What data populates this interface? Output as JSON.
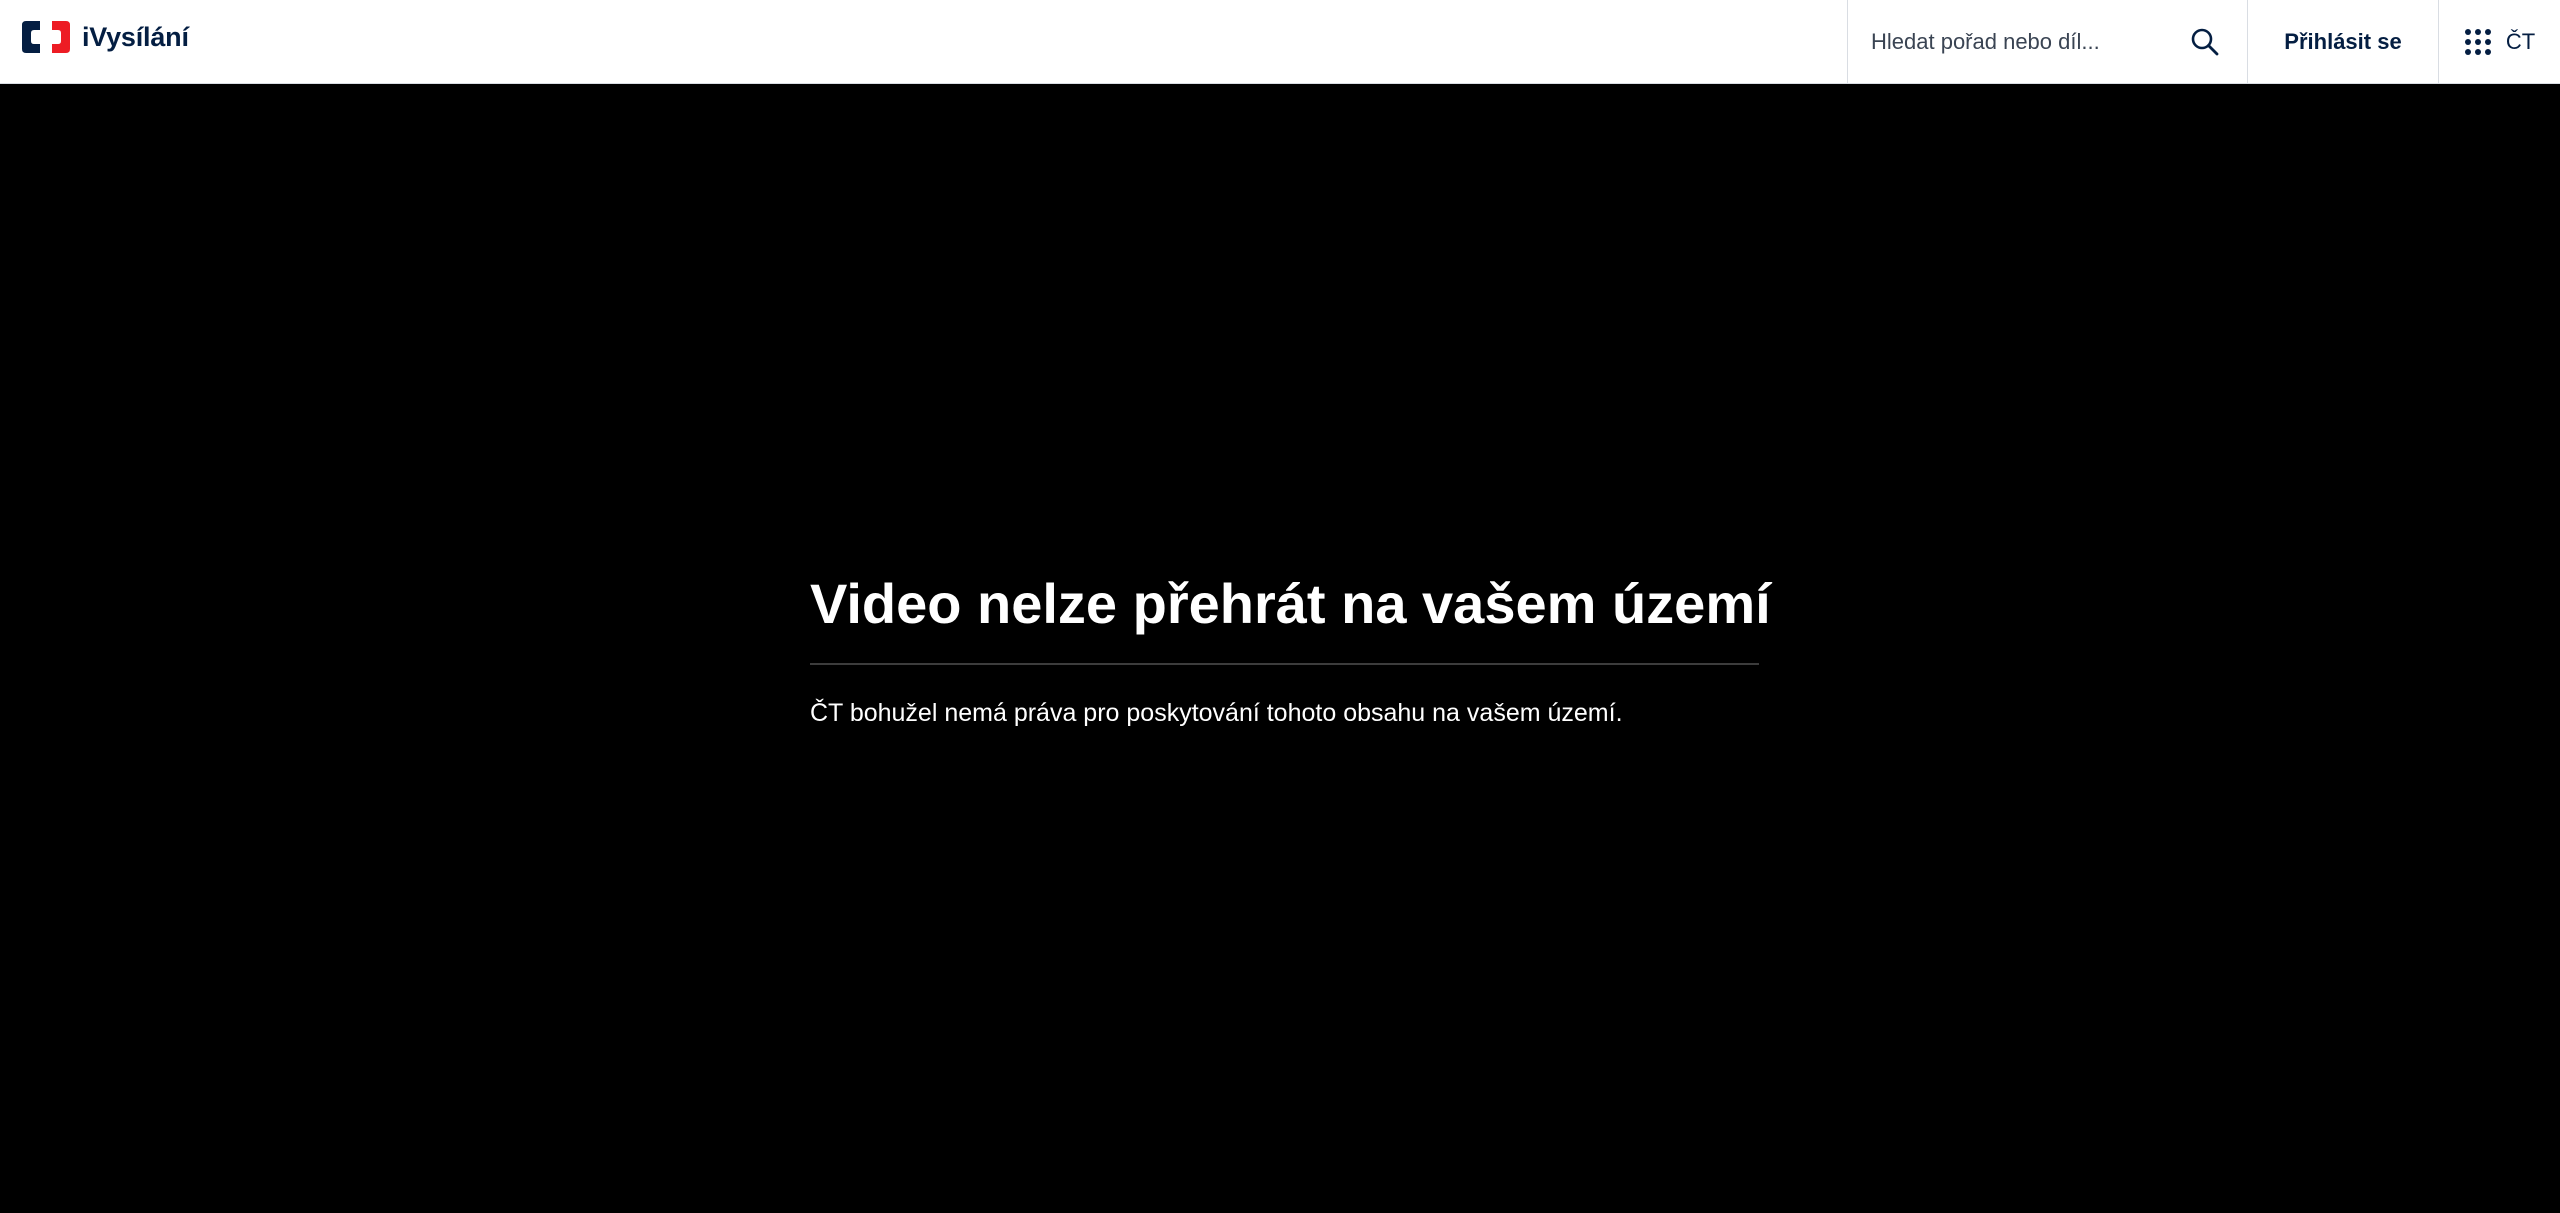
{
  "header": {
    "logo_text": "iVysílání",
    "brand_colors": {
      "navy": "#041e42",
      "red": "#ed1c24"
    },
    "search": {
      "placeholder": "Hledat pořad nebo díl...",
      "value": "",
      "icon": "search-icon"
    },
    "login_label": "Přihlásit se",
    "ct_menu": {
      "icon": "grid-dots-icon",
      "label": "ČT"
    }
  },
  "player": {
    "title": "Video nelze přehrát na vašem území",
    "message": "ČT bohužel nemá práva pro poskytování tohoto obsahu na vašem území."
  }
}
